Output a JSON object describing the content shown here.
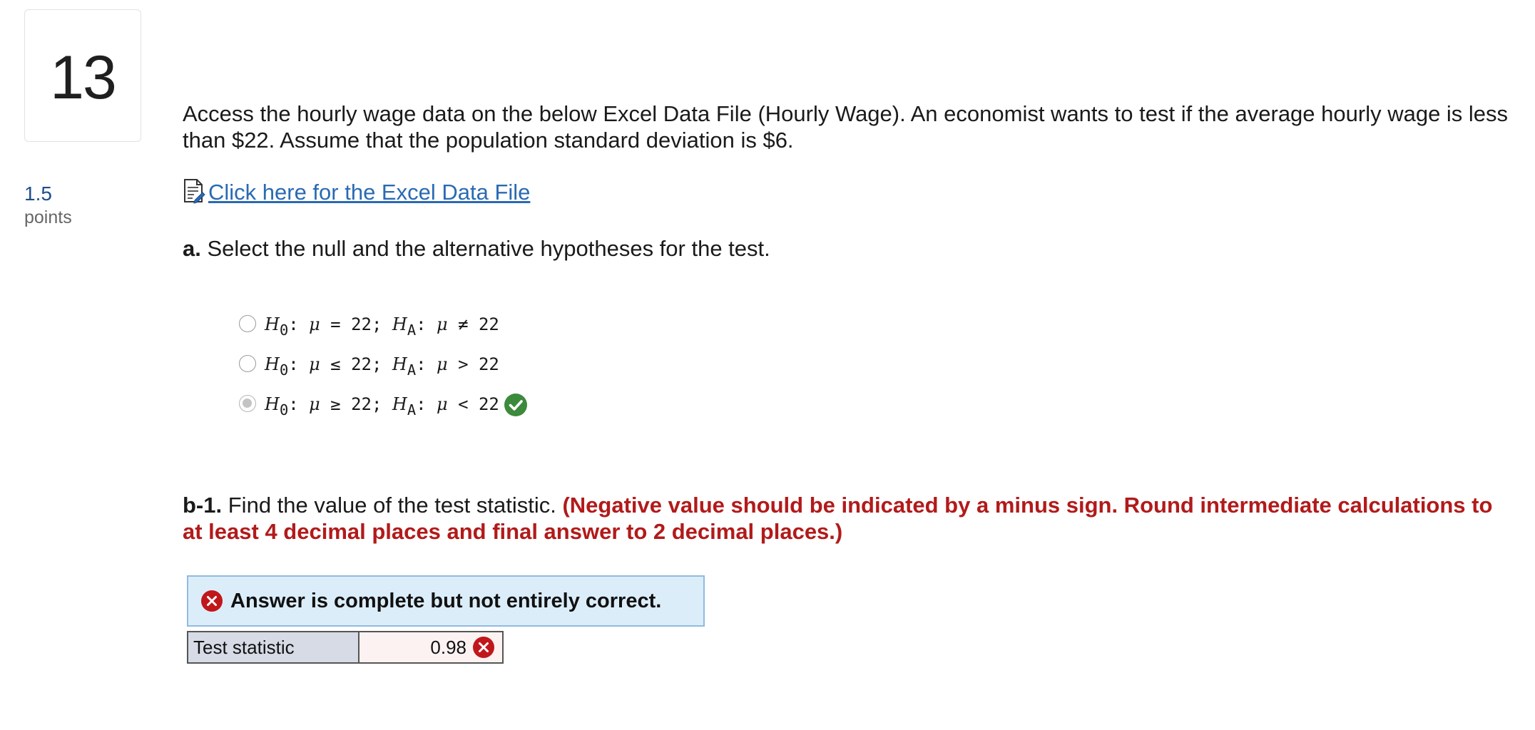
{
  "question": {
    "number": "13",
    "points_value": "1.5",
    "points_label": "points",
    "prompt": "Access the hourly wage data on the below Excel Data File (Hourly Wage). An economist wants to test if the average hourly wage is less than $22. Assume that the population standard deviation is $6.",
    "excel_link_text": "Click here for the Excel Data File"
  },
  "part_a": {
    "label": "a.",
    "text": "Select the null and the alternative hypotheses for the test.",
    "options": [
      {
        "h0": "H",
        "h0_sub": "0",
        "colon1": ": ",
        "mu1": "μ",
        "rel1": " = 22; ",
        "ha": "H",
        "ha_sub": "A",
        "colon2": ": ",
        "mu2": "μ",
        "rel2": " ≠ 22",
        "selected": false
      },
      {
        "h0": "H",
        "h0_sub": "0",
        "colon1": ": ",
        "mu1": "μ",
        "rel1": " ≤ 22; ",
        "ha": "H",
        "ha_sub": "A",
        "colon2": ": ",
        "mu2": "μ",
        "rel2": " > 22",
        "selected": false
      },
      {
        "h0": "H",
        "h0_sub": "0",
        "colon1": ": ",
        "mu1": "μ",
        "rel1": " ≥ 22; ",
        "ha": "H",
        "ha_sub": "A",
        "colon2": ": ",
        "mu2": "μ",
        "rel2": " < 22",
        "selected": true,
        "status_icon": "check-circle-icon"
      }
    ]
  },
  "part_b1": {
    "label": "b-1.",
    "text": "Find the value of the test statistic.",
    "note": "(Negative value should be indicated by a minus sign. Round intermediate calculations to at least 4 decimal places and final answer to 2 decimal places.)",
    "feedback": "Answer is complete but not entirely correct.",
    "table": {
      "label": "Test statistic",
      "value": "0.98",
      "status_icon": "x-circle-icon"
    }
  },
  "colors": {
    "link": "#2a6ab3",
    "points": "#1e4e8c",
    "note_red": "#b21a1a",
    "correct_green": "#3c8a3c",
    "incorrect_red": "#c0171b",
    "banner_bg": "#dcedfa",
    "banner_border": "#8fbbe0"
  }
}
